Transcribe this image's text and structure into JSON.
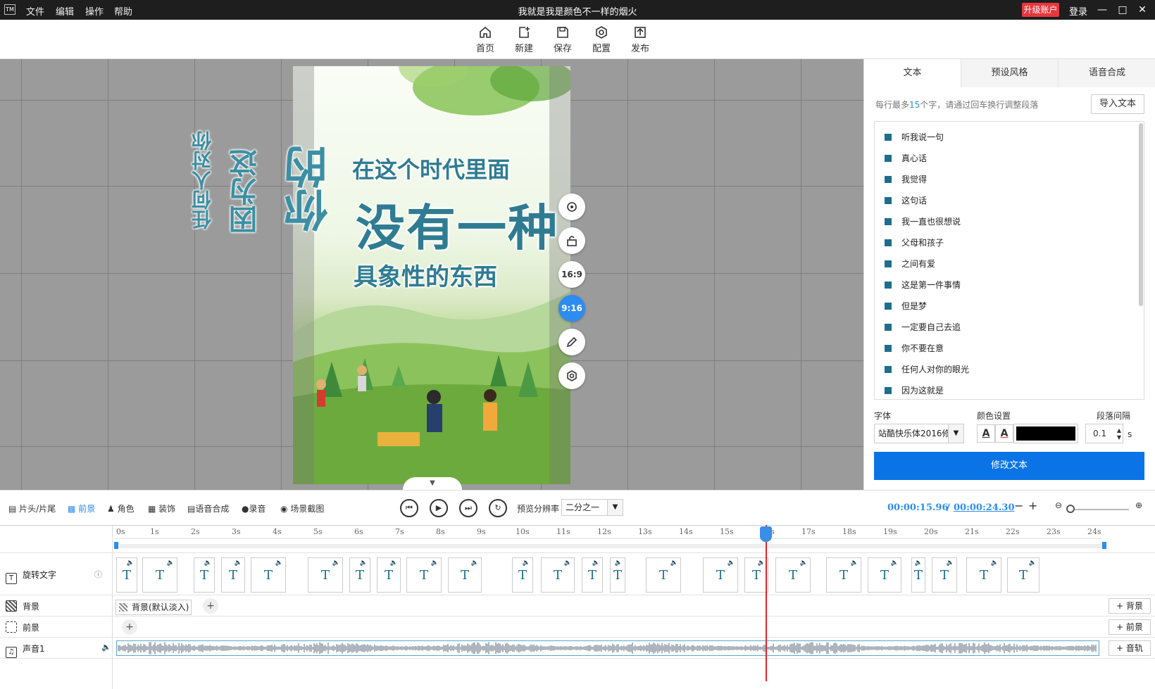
{
  "titlebar": {
    "logo": "TM",
    "menus": [
      "文件",
      "编辑",
      "操作",
      "帮助"
    ],
    "title": "我就是我是颜色不一样的烟火",
    "upgrade": "升级账户",
    "login": "登录"
  },
  "toolbar": {
    "items": [
      {
        "label": "首页",
        "icon": "home-icon"
      },
      {
        "label": "新建",
        "icon": "new-icon"
      },
      {
        "label": "保存",
        "icon": "save-icon"
      },
      {
        "label": "配置",
        "icon": "config-icon"
      },
      {
        "label": "发布",
        "icon": "publish-icon"
      }
    ]
  },
  "canvas": {
    "vertical_texts": [
      "任何人对你",
      "因为这",
      "你的"
    ],
    "lines": [
      "在这个时代里面",
      "没有一种",
      "具象性的东西"
    ],
    "float_buttons": [
      "16:9",
      "9:16"
    ],
    "active_ratio": "9:16"
  },
  "right_panel": {
    "tabs": [
      "文本",
      "预设风格",
      "语音合成"
    ],
    "active_tab": "文本",
    "hint_prefix": "每行最多",
    "hint_count": "15",
    "hint_suffix": "个字，请通过回车换行调整段落",
    "import_label": "导入文本",
    "text_items": [
      "听我说一句",
      "真心话",
      "我觉得",
      "这句话",
      "我一直也很想说",
      "父母和孩子",
      "之间有爱",
      "这是第一件事情",
      "但是梦",
      "一定要自己去追",
      "你不要在意",
      "任何人对你的眼光",
      "因为这就是"
    ],
    "font_label": "字体",
    "font_value": "站酷快乐体2016修",
    "color_label": "颜色设置",
    "color_value": "#000000",
    "spacing_label": "段落间隔",
    "spacing_value": "0.1",
    "spacing_unit": "s",
    "modify_label": "修改文本"
  },
  "controls": {
    "tabs": [
      "片头/片尾",
      "前景",
      "角色",
      "装饰",
      "语音合成",
      "录音",
      "场景截图"
    ],
    "active_tab": "前景",
    "preview_res_label": "预览分辨率",
    "preview_res_value": "二分之一",
    "time_current": "00:00:15.96",
    "time_sep": "/",
    "time_total": "00:00:24.30"
  },
  "timeline": {
    "ticks": [
      "0s",
      "1s",
      "2s",
      "3s",
      "4s",
      "5s",
      "6s",
      "7s",
      "8s",
      "9s",
      "10s",
      "11s",
      "12s",
      "13s",
      "14s",
      "15s",
      "16s",
      "17s",
      "18s",
      "19s",
      "20s",
      "21s",
      "22s",
      "23s",
      "24s"
    ],
    "tracks": {
      "rotate_text": "旋转文字",
      "background": "背景",
      "foreground": "前景",
      "audio": "声音1"
    },
    "bg_clip": "背景(默认淡入)",
    "add_bg": "背景",
    "add_fg": "前景",
    "add_audio": "音轨",
    "clip_letter": "T"
  }
}
